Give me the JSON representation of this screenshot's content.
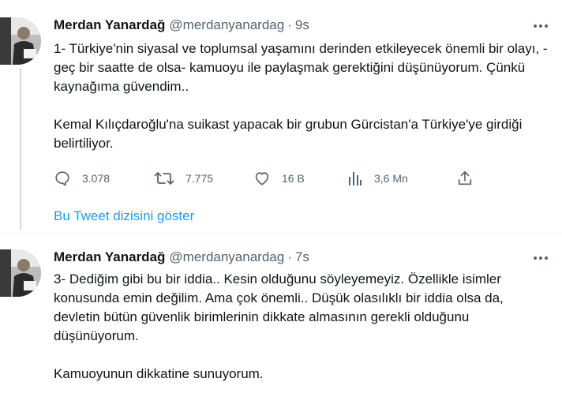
{
  "tweet1": {
    "name": "Merdan Yanardağ",
    "handle": "@merdanyanardag",
    "dot": "·",
    "time": "9s",
    "para1": "1- Türkiye'nin siyasal ve toplumsal yaşamını derinden etkileyecek önemli bir olayı, -geç bir saatte de olsa- kamuoyu ile paylaşmak gerektiğini düşünüyorum. Çünkü kaynağıma güvendim..",
    "para2": "Kemal Kılıçdaroğlu'na suikast yapacak bir grubun Gürcistan'a Türkiye'ye girdiği belirtiliyor.",
    "replies": "3.078",
    "retweets": "7.775",
    "likes": "16 B",
    "views": "3,6 Mn"
  },
  "show_thread": "Bu Tweet dizisini göster",
  "tweet2": {
    "name": "Merdan Yanardağ",
    "handle": "@merdanyanardag",
    "dot": "·",
    "time": "7s",
    "para1": "3- Dediğim gibi bu bir iddia.. Kesin olduğunu söyleyemeyiz. Özellikle isimler konusunda emin değilim. Ama çok önemli.. Düşük olasılıklı bir iddia olsa da, devletin bütün güvenlik birimlerinin dikkate almasının gerekli olduğunu düşünüyorum.",
    "para2": "Kamuoyunun dikkatine sunuyorum."
  },
  "icons": {
    "reply": "reply-icon",
    "retweet": "retweet-icon",
    "like": "heart-icon",
    "views": "analytics-icon",
    "share": "share-icon",
    "more": "more-icon"
  },
  "colors": {
    "text": "#0f1419",
    "secondary": "#536471",
    "link": "#1d9bf0",
    "thread_line": "#cfd9de"
  }
}
